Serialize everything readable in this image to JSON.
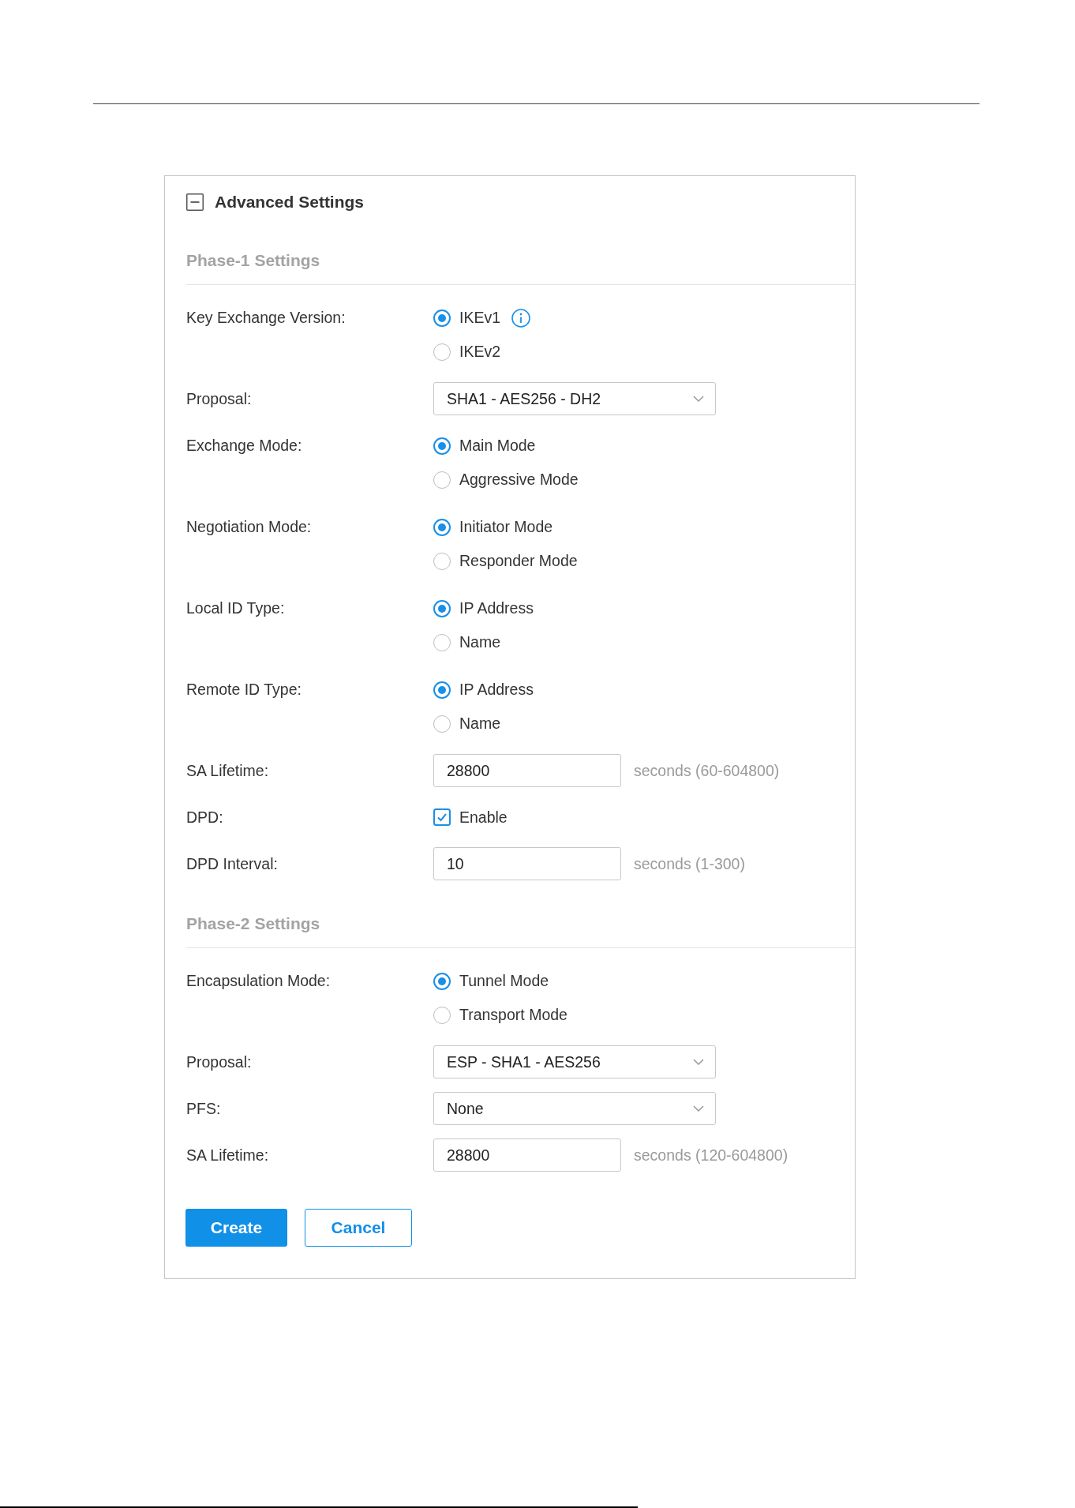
{
  "panel": {
    "title": "Advanced Settings",
    "expanded": true
  },
  "sections": [
    {
      "title": "Phase-1 Settings",
      "fields": [
        {
          "kind": "radio",
          "label": "Key Exchange Version:",
          "options": [
            {
              "label": "IKEv1",
              "selected": true,
              "info": true
            },
            {
              "label": "IKEv2",
              "selected": false
            }
          ]
        },
        {
          "kind": "select",
          "label": "Proposal:",
          "value": "SHA1 - AES256 - DH2"
        },
        {
          "kind": "radio",
          "label": "Exchange Mode:",
          "options": [
            {
              "label": "Main Mode",
              "selected": true
            },
            {
              "label": "Aggressive Mode",
              "selected": false
            }
          ]
        },
        {
          "kind": "radio",
          "label": "Negotiation Mode:",
          "options": [
            {
              "label": "Initiator Mode",
              "selected": true
            },
            {
              "label": "Responder Mode",
              "selected": false
            }
          ]
        },
        {
          "kind": "radio",
          "label": "Local ID Type:",
          "options": [
            {
              "label": "IP Address",
              "selected": true
            },
            {
              "label": "Name",
              "selected": false
            }
          ]
        },
        {
          "kind": "radio",
          "label": "Remote ID Type:",
          "options": [
            {
              "label": "IP Address",
              "selected": true
            },
            {
              "label": "Name",
              "selected": false
            }
          ]
        },
        {
          "kind": "input",
          "label": "SA Lifetime:",
          "value": "28800",
          "hint": "seconds (60-604800)"
        },
        {
          "kind": "checkbox",
          "label": "DPD:",
          "option": "Enable",
          "checked": true
        },
        {
          "kind": "input",
          "label": "DPD Interval:",
          "value": "10",
          "hint": "seconds (1-300)"
        }
      ]
    },
    {
      "title": "Phase-2 Settings",
      "fields": [
        {
          "kind": "radio",
          "label": "Encapsulation Mode:",
          "options": [
            {
              "label": "Tunnel Mode",
              "selected": true
            },
            {
              "label": "Transport Mode",
              "selected": false
            }
          ]
        },
        {
          "kind": "select",
          "label": "Proposal:",
          "value": "ESP - SHA1 - AES256"
        },
        {
          "kind": "select",
          "label": "PFS:",
          "value": "None"
        },
        {
          "kind": "input",
          "label": "SA Lifetime:",
          "value": "28800",
          "hint": "seconds (120-604800)"
        }
      ]
    }
  ],
  "buttons": [
    {
      "label": "Create",
      "kind": "primary"
    },
    {
      "label": "Cancel",
      "kind": "secondary"
    }
  ]
}
